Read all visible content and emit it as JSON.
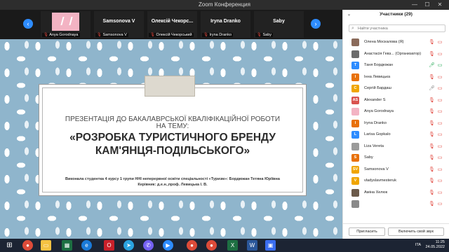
{
  "window": {
    "title": "Zoom Конференция"
  },
  "gallery": {
    "tiles": [
      {
        "name": "",
        "footer": "Anya Gorodnaya",
        "type": "pink"
      },
      {
        "name": "Samsonova V",
        "footer": "Samsonova V"
      },
      {
        "name": "Олексій Чекорс...",
        "footer": "Олексій Чекорський"
      },
      {
        "name": "Iryna Dranko",
        "footer": "Iryna Dranko"
      },
      {
        "name": "Saby",
        "footer": "Saby"
      }
    ]
  },
  "slide": {
    "subtitle_line1": "ПРЕЗЕНТАЦІЯ ДО БАКАЛАВРСЬКОЇ КВАЛІФІКАЦІЙНОЇ РОБОТИ",
    "subtitle_line2": "НА ТЕМУ:",
    "title_line1": "«РОЗРОБКА ТУРИСТИЧНОГО БРЕНДУ",
    "title_line2": "КАМ'ЯНЦЯ-ПОДІЛЬСЬКОГО»",
    "author_line1": "Виконала студентка 4 курсу 1 групи ННІ неперервної освіти спеціальності «Туризм»: Бордюжан Тетяна Юріївна",
    "author_line2": "Керівник: д.е.н.,проф. Левицька І. В."
  },
  "participants": {
    "header": "Участники (29)",
    "search_placeholder": "Найти участника",
    "items": [
      {
        "name": "Олена Москалова (Я)",
        "initial": "",
        "color": "#8a6a5a",
        "mic": "off",
        "cam": "off"
      },
      {
        "name": "Анастасія Гевз... (Организатор)",
        "initial": "",
        "color": "#6b6b6b",
        "mic": "off",
        "cam": "off"
      },
      {
        "name": "Таня Бордюжан",
        "initial": "T",
        "color": "#2d8cff",
        "mic": "on-green",
        "cam": "on"
      },
      {
        "name": "Інна Левицька",
        "initial": "І",
        "color": "#e8710a",
        "mic": "off",
        "cam": "off"
      },
      {
        "name": "Сергій Бардаш",
        "initial": "С",
        "color": "#f0a500",
        "mic": "on",
        "cam": "off"
      },
      {
        "name": "Alexander S",
        "initial": "AS",
        "color": "#d9534f",
        "mic": "off",
        "cam": "off"
      },
      {
        "name": "Anya Gorodnaya",
        "initial": "",
        "color": "#f3b3c3",
        "mic": "off",
        "cam": "off"
      },
      {
        "name": "Iryna Dranko",
        "initial": "I",
        "color": "#e8710a",
        "mic": "off",
        "cam": "off"
      },
      {
        "name": "Larisa Gopkalo",
        "initial": "L",
        "color": "#2d8cff",
        "mic": "off",
        "cam": "off"
      },
      {
        "name": "Liza Vereta",
        "initial": "",
        "color": "#9b9b9b",
        "mic": "off",
        "cam": "off"
      },
      {
        "name": "Saby",
        "initial": "S",
        "color": "#e8710a",
        "mic": "off",
        "cam": "off"
      },
      {
        "name": "Samsonova V",
        "initial": "SV",
        "color": "#f0a500",
        "mic": "off",
        "cam": "off"
      },
      {
        "name": "vladyslavmesteruk",
        "initial": "V",
        "color": "#f0a500",
        "mic": "off",
        "cam": "off"
      },
      {
        "name": "Аміна Хелюк",
        "initial": "",
        "color": "#6b5a4a",
        "mic": "off",
        "cam": "off"
      },
      {
        "name": "",
        "initial": "",
        "color": "#8a8a8a",
        "mic": "off",
        "cam": "off"
      }
    ],
    "invite_label": "Пригласить",
    "unmute_label": "Включить свой звук"
  },
  "taskbar": {
    "tray_lang": "ITA",
    "time": "11:25",
    "date": "24.05.2022"
  }
}
